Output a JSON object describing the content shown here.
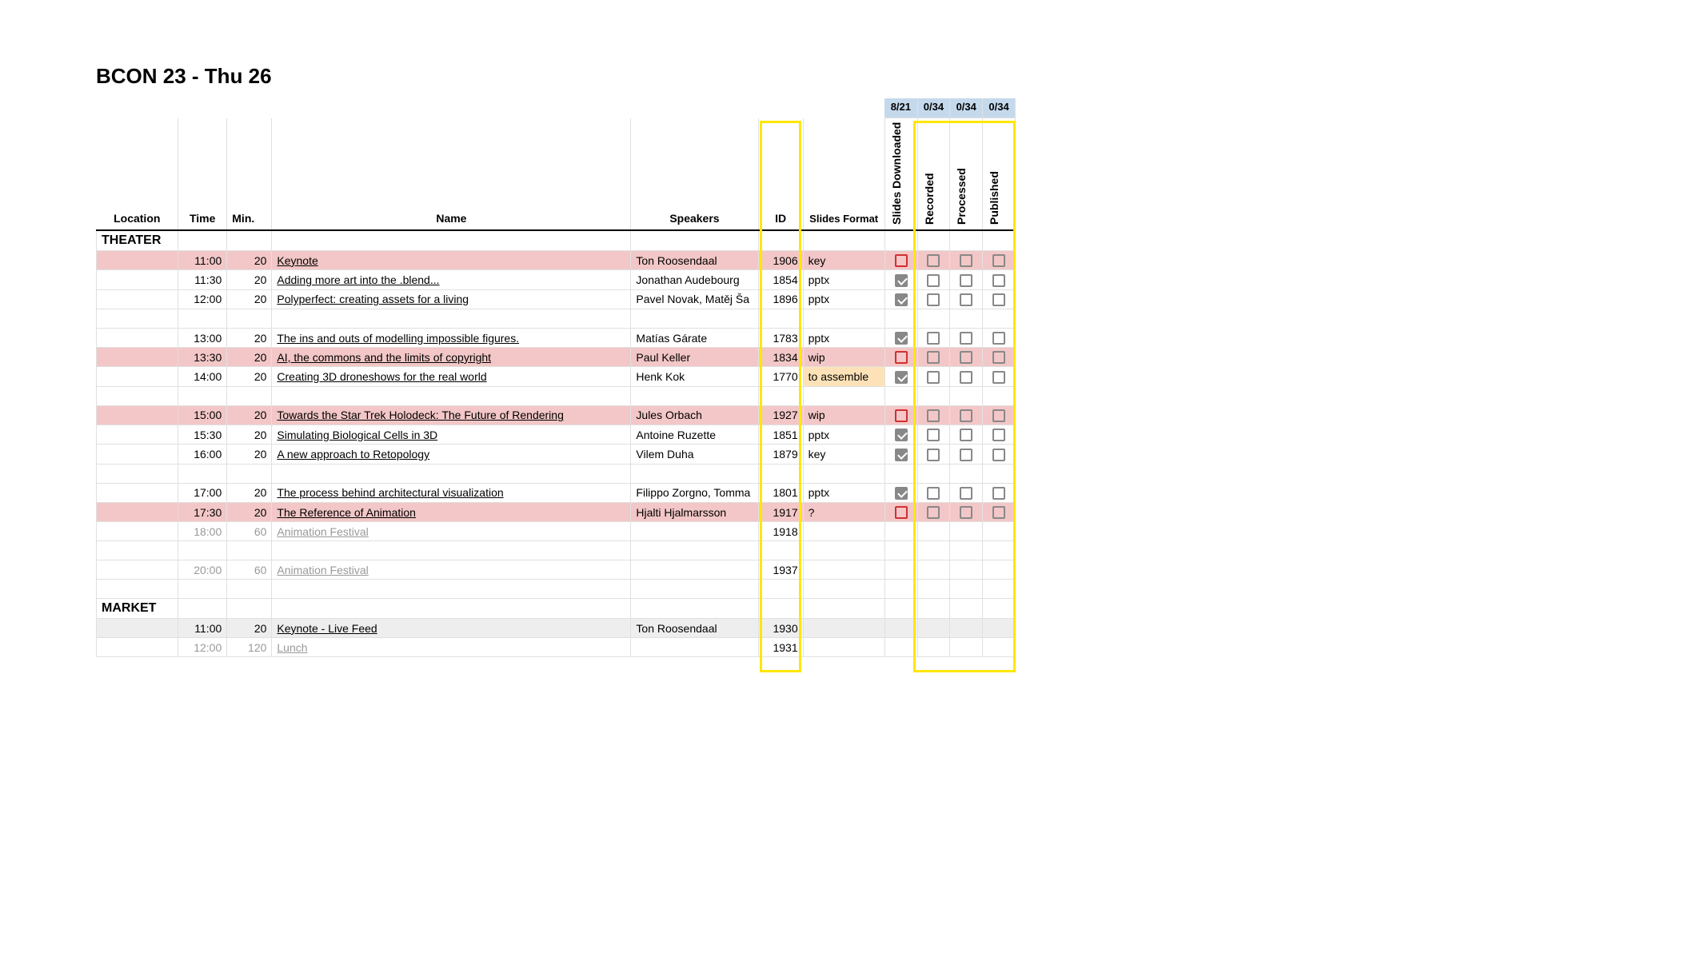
{
  "title": "BCON 23 - Thu 26",
  "stats": {
    "slides": "8/21",
    "recorded": "0/34",
    "processed": "0/34",
    "published": "0/34"
  },
  "headers": {
    "location": "Location",
    "time": "Time",
    "min": "Min.",
    "name": "Name",
    "speakers": "Speakers",
    "id": "ID",
    "slides_format": "Slides Format",
    "slides_downloaded": "Slides Downloaded",
    "recorded": "Recorded",
    "processed": "Processed",
    "published": "Published"
  },
  "sections": [
    {
      "label": "THEATER",
      "rows": [
        {
          "type": "talk",
          "time": "11:00",
          "min": "20",
          "name": "Keynote",
          "speakers": "Ton Roosendaal",
          "id": "1906",
          "fmt": "key",
          "slides": "red",
          "rec": "empty",
          "proc": "empty",
          "pub": "empty",
          "cls": "pink"
        },
        {
          "type": "talk",
          "time": "11:30",
          "min": "20",
          "name": "Adding more art into the .blend...",
          "speakers": "Jonathan Audebourg",
          "id": "1854",
          "fmt": "pptx",
          "slides": "checked",
          "rec": "empty",
          "proc": "empty",
          "pub": "empty",
          "cls": ""
        },
        {
          "type": "talk",
          "time": "12:00",
          "min": "20",
          "name": "Polyperfect: creating assets for a living",
          "speakers": "Pavel Novak, Matěj Ša",
          "id": "1896",
          "fmt": "pptx",
          "slides": "checked",
          "rec": "empty",
          "proc": "empty",
          "pub": "empty",
          "cls": ""
        },
        {
          "type": "blank"
        },
        {
          "type": "talk",
          "time": "13:00",
          "min": "20",
          "name": "The ins and outs of modelling impossible figures.",
          "speakers": "Matías Gárate",
          "id": "1783",
          "fmt": "pptx",
          "slides": "checked",
          "rec": "empty",
          "proc": "empty",
          "pub": "empty",
          "cls": ""
        },
        {
          "type": "talk",
          "time": "13:30",
          "min": "20",
          "name": "AI, the commons and the limits of copyright",
          "speakers": "Paul Keller",
          "id": "1834",
          "fmt": "wip",
          "slides": "red",
          "rec": "empty",
          "proc": "empty",
          "pub": "empty",
          "cls": "pink"
        },
        {
          "type": "talk",
          "time": "14:00",
          "min": "20",
          "name": "Creating 3D droneshows for the real world",
          "speakers": "Henk Kok",
          "id": "1770",
          "fmt": "to assemble",
          "fmtCls": "orange-cell",
          "slides": "checked",
          "rec": "empty",
          "proc": "empty",
          "pub": "empty",
          "cls": ""
        },
        {
          "type": "blank"
        },
        {
          "type": "talk",
          "time": "15:00",
          "min": "20",
          "name": "Towards the Star Trek Holodeck: The Future of Rendering",
          "speakers": "Jules Orbach",
          "id": "1927",
          "fmt": "wip",
          "slides": "red",
          "rec": "empty",
          "proc": "empty",
          "pub": "empty",
          "cls": "pink"
        },
        {
          "type": "talk",
          "time": "15:30",
          "min": "20",
          "name": "Simulating Biological Cells in 3D",
          "speakers": "Antoine Ruzette",
          "id": "1851",
          "fmt": "pptx",
          "slides": "checked",
          "rec": "empty",
          "proc": "empty",
          "pub": "empty",
          "cls": ""
        },
        {
          "type": "talk",
          "time": "16:00",
          "min": "20",
          "name": "A new approach to Retopology",
          "speakers": "Vilem Duha",
          "id": "1879",
          "fmt": "key",
          "slides": "checked",
          "rec": "empty",
          "proc": "empty",
          "pub": "empty",
          "cls": ""
        },
        {
          "type": "blank"
        },
        {
          "type": "talk",
          "time": "17:00",
          "min": "20",
          "name": "The process behind architectural visualization",
          "speakers": "Filippo Zorgno, Tomma",
          "id": "1801",
          "fmt": "pptx",
          "slides": "checked",
          "rec": "empty",
          "proc": "empty",
          "pub": "empty",
          "cls": ""
        },
        {
          "type": "talk",
          "time": "17:30",
          "min": "20",
          "name": "The Reference of Animation",
          "speakers": "Hjalti Hjalmarsson",
          "id": "1917",
          "fmt": "?",
          "slides": "red",
          "rec": "empty",
          "proc": "empty",
          "pub": "empty",
          "cls": "pink"
        },
        {
          "type": "talk",
          "time": "18:00",
          "min": "60",
          "name": "Animation Festival",
          "speakers": "",
          "id": "1918",
          "fmt": "",
          "slides": "none",
          "rec": "none",
          "proc": "none",
          "pub": "none",
          "cls": "",
          "dim": true
        },
        {
          "type": "blank"
        },
        {
          "type": "talk",
          "time": "20:00",
          "min": "60",
          "name": "Animation Festival",
          "speakers": "",
          "id": "1937",
          "fmt": "",
          "slides": "none",
          "rec": "none",
          "proc": "none",
          "pub": "none",
          "cls": "",
          "dim": true
        },
        {
          "type": "blank"
        }
      ]
    },
    {
      "label": "MARKET",
      "rows": [
        {
          "type": "talk",
          "time": "11:00",
          "min": "20",
          "name": "Keynote - Live Feed",
          "speakers": "Ton Roosendaal",
          "id": "1930",
          "fmt": "",
          "slides": "none",
          "rec": "none",
          "proc": "none",
          "pub": "none",
          "cls": "grey"
        },
        {
          "type": "talk",
          "time": "12:00",
          "min": "120",
          "name": "Lunch",
          "speakers": "",
          "id": "1931",
          "fmt": "",
          "slides": "none",
          "rec": "none",
          "proc": "none",
          "pub": "none",
          "cls": "",
          "dim": true
        }
      ]
    }
  ]
}
